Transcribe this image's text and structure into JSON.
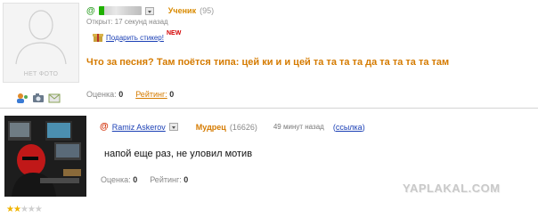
{
  "post1": {
    "avatar_label": "НЕТ ФОТО",
    "rank": "Ученик",
    "rank_points": "(95)",
    "opened": "Открыт: 17 секунд назад",
    "gift_label": "Подарить стикер!",
    "new_badge": "NEW",
    "question": "Что за песня? Там поётся типа: цей ки и и цей та та та та да та та та та там",
    "rating_label": "Оценка:",
    "rating_value": "0",
    "rank_label": "Рейтинг:",
    "rank_value": "0"
  },
  "post2": {
    "author": "Ramiz Askerov",
    "rank": "Мудрец",
    "rank_points": "(16626)",
    "time": "49 минут назад",
    "link_label": "ссылка",
    "answer": "напой еще раз, не уловил мотив",
    "rating_label": "Оценка:",
    "rating_value": "0",
    "rank_label": "Рейтинг:",
    "rank_value": "0"
  },
  "stars": {
    "filled": 2,
    "total": 5
  },
  "watermark": "YAPLAKAL.COM",
  "colors": {
    "accent_orange": "#d57b00",
    "link_blue": "#1a3fb5",
    "green": "#2f9e27"
  }
}
